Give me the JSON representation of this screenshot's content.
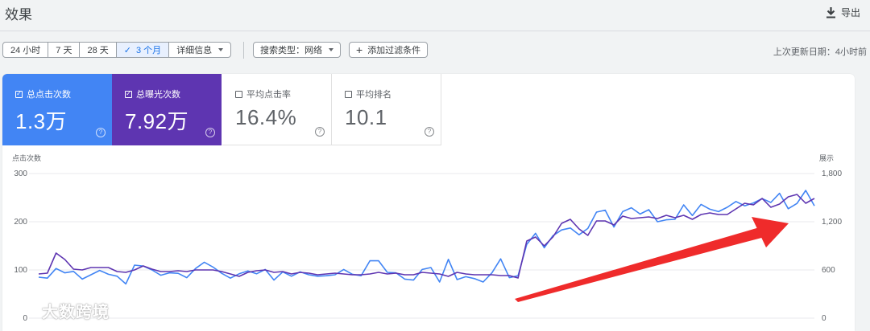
{
  "header": {
    "title": "效果",
    "export_label": "导出"
  },
  "toolbar": {
    "ranges": [
      "24 小时",
      "7 天",
      "28 天",
      "3 个月"
    ],
    "active_range": "3 个月",
    "details_label": "详细信息",
    "search_type_label": "搜索类型：网络",
    "add_filter_label": "添加过滤条件",
    "last_updated": "上次更新日期：4小时前"
  },
  "metrics": [
    {
      "label": "总点击次数",
      "value": "1.3万",
      "checked": true,
      "color": "#4285f4"
    },
    {
      "label": "总曝光次数",
      "value": "7.92万",
      "checked": true,
      "color": "#5e35b1"
    },
    {
      "label": "平均点击率",
      "value": "16.4%",
      "checked": false
    },
    {
      "label": "平均排名",
      "value": "10.1",
      "checked": false
    }
  ],
  "watermark": {
    "text": "大数跨境"
  },
  "chart_data": {
    "type": "line",
    "left_axis": {
      "label": "点击次数",
      "ticks": [
        "300",
        "200",
        "100",
        "0"
      ],
      "range": [
        0,
        300
      ]
    },
    "right_axis": {
      "label": "展示",
      "ticks": [
        "1,800",
        "1,200",
        "600",
        "0"
      ],
      "range": [
        0,
        1800
      ]
    },
    "grid": true,
    "series": [
      {
        "axis": "left",
        "color": "#4285f4",
        "values": [
          85,
          83,
          103,
          94,
          97,
          81,
          90,
          99,
          91,
          87,
          71,
          110,
          108,
          100,
          89,
          94,
          93,
          84,
          103,
          116,
          106,
          93,
          83,
          92,
          98,
          92,
          101,
          79,
          96,
          87,
          96,
          90,
          87,
          88,
          90,
          101,
          91,
          88,
          119,
          119,
          95,
          94,
          81,
          79,
          101,
          105,
          75,
          122,
          80,
          86,
          82,
          75,
          94,
          123,
          84,
          88,
          153,
          176,
          146,
          171,
          183,
          187,
          173,
          186,
          220,
          224,
          189,
          221,
          229,
          216,
          225,
          200,
          204,
          205,
          235,
          213,
          236,
          226,
          221,
          230,
          242,
          233,
          239,
          248,
          240,
          259,
          227,
          238,
          265,
          233
        ]
      },
      {
        "axis": "right",
        "color": "#5e35b1",
        "values": [
          550,
          560,
          810,
          730,
          610,
          600,
          630,
          630,
          630,
          580,
          570,
          600,
          650,
          610,
          580,
          580,
          590,
          580,
          600,
          600,
          600,
          580,
          550,
          520,
          570,
          590,
          600,
          570,
          580,
          550,
          570,
          560,
          540,
          550,
          560,
          550,
          540,
          540,
          550,
          570,
          550,
          560,
          540,
          540,
          570,
          560,
          550,
          520,
          570,
          550,
          540,
          540,
          540,
          530,
          530,
          500,
          960,
          1010,
          900,
          1010,
          1180,
          1230,
          1110,
          1030,
          1210,
          1210,
          1160,
          1270,
          1240,
          1250,
          1260,
          1240,
          1280,
          1250,
          1280,
          1230,
          1290,
          1310,
          1290,
          1290,
          1360,
          1430,
          1410,
          1490,
          1380,
          1420,
          1510,
          1540,
          1430,
          1490
        ]
      }
    ],
    "annotation": {
      "type": "arrow",
      "color": "#ef2b2b"
    }
  }
}
